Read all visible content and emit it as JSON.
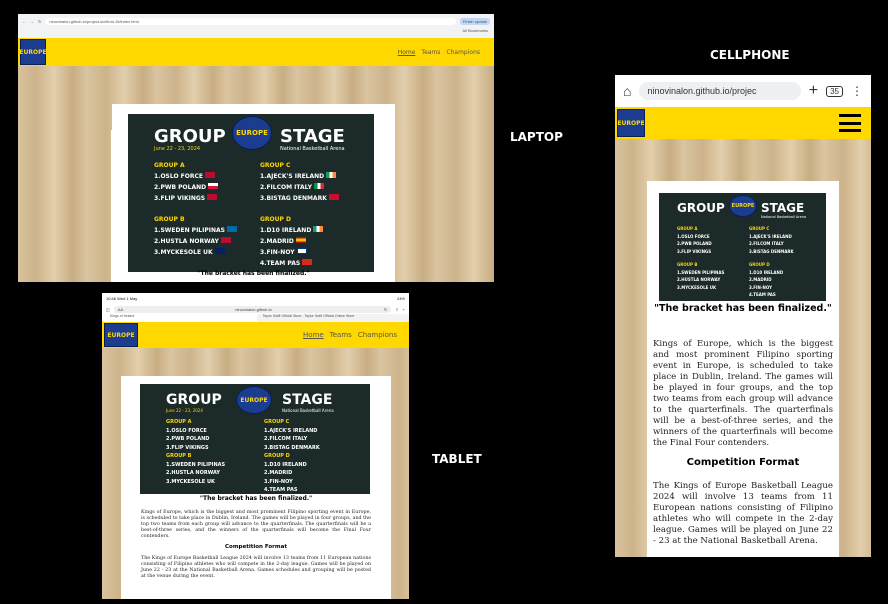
{
  "labels": {
    "laptop": "LAPTOP",
    "cellphone": "CELLPHONE",
    "tablet": "TABLET"
  },
  "laptop": {
    "url": "ninovinalon.github.io/project-six/final-15/index.html",
    "update_btn": "Finish update",
    "bookmarks": "All Bookmarks",
    "nav": [
      "Home",
      "Teams",
      "Champions"
    ]
  },
  "poster": {
    "title_left": "GROUP",
    "title_right": "STAGE",
    "logo": "EUROPE",
    "date": "June 22 - 23, 2024",
    "venue": "National Basketball Arena",
    "groups": [
      {
        "name": "GROUP A",
        "teams": [
          "1.OSLO FORCE",
          "2.PWB POLAND",
          "3.FLIP VIKINGS"
        ]
      },
      {
        "name": "GROUP C",
        "teams": [
          "1.AJECK'S IRELAND",
          "2.FILCOM ITALY",
          "3.BISTAG DENMARK"
        ]
      },
      {
        "name": "GROUP B",
        "teams": [
          "1.SWEDEN PILIPINAS",
          "2.HUSTLA NORWAY",
          "3.MYCKESOLE UK"
        ]
      },
      {
        "name": "GROUP D",
        "teams": [
          "1.D10 IRELAND",
          "2.MADRID",
          "3.FIN-NOY",
          "4.TEAM PAS"
        ]
      }
    ],
    "caption": "\"The bracket has been finalized.\""
  },
  "tablet": {
    "status_time": "10:46",
    "status_date": "Wed 1 May",
    "status_battery": "24%",
    "address": "ninovinalon.github.io",
    "aa": "AA",
    "tab1": "Kings of Ireland",
    "tab2": "Taylor Swift Official Store - Taylor Swift Official Online Store",
    "nav": [
      "Home",
      "Teams",
      "Champions"
    ],
    "paragraph": "Kings of Europe, which is the biggest and most prominent Filipino sporting event in Europe, is scheduled to take place in Dublin, Ireland. The games will be played in four groups, and the top two teams from each group will advance to the quarterfinals. The quarterfinals will be a best-of-three series, and the winners of the quarterfinals will become the Final Four contenders.",
    "heading": "Competition Format",
    "paragraph2": "The Kings of Europe Basketball League 2024 will involve 13 teams from 11 European nations consisting of Filipino athletes who will compete in the 2-day league. Games will be played on June 22 - 23 at the National Basketball Arena. Games schedules and grouping will be posted at the venue during the event."
  },
  "phone": {
    "url": "ninovinalon.github.io/projec",
    "tabs_count": "35",
    "paragraph": "Kings of Europe, which is the biggest and most prominent Filipino sporting event in Europe, is scheduled to take place in Dublin, Ireland. The games will be played in four groups, and the top two teams from each group will advance to the quarterfinals. The quarterfinals will be a best-of-three series, and the winners of the quarterfinals will become the Final Four contenders.",
    "heading": "Competition Format",
    "paragraph2": "The Kings of Europe Basketball League 2024 will involve 13 teams from 11 European nations consisting of Filipino athletes who will compete in the 2-day league. Games will be played on June 22 - 23 at the National Basketball Arena."
  }
}
